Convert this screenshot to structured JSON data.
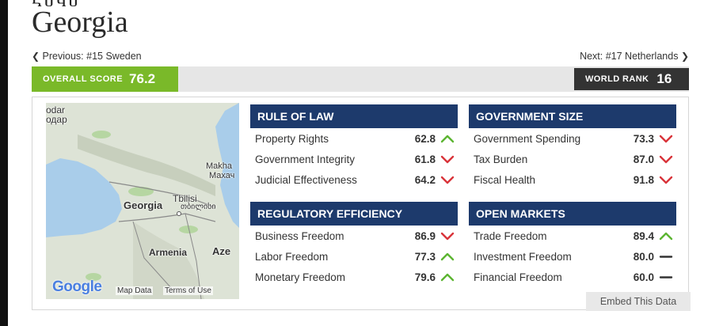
{
  "title_glyphs": "ႾႱႩႱ",
  "title": "Georgia",
  "navigation": {
    "previous_label": "Previous: #15 Sweden",
    "next_label": "Next: #17 Netherlands"
  },
  "overall_score": {
    "label": "OVERALL SCORE",
    "value": "76.2",
    "color": "#7ab929"
  },
  "world_rank": {
    "label": "WORLD RANK",
    "value": "16"
  },
  "map": {
    "labels": {
      "top_left_1": "odar",
      "top_left_2": "одар",
      "makha_1": "Makha",
      "makha_2": "Махач",
      "tbilisi_1": "Tbilisi",
      "tbilisi_2": "თბილისი",
      "georgia": "Georgia",
      "armenia": "Armenia",
      "aze": "Aze"
    },
    "google_logo": "Google",
    "map_data": "Map Data",
    "terms": "Terms of Use"
  },
  "categories": [
    {
      "title": "RULE OF LAW",
      "rows": [
        {
          "name": "Property Rights",
          "score": "62.8",
          "trend": "up"
        },
        {
          "name": "Government Integrity",
          "score": "61.8",
          "trend": "down"
        },
        {
          "name": "Judicial Effectiveness",
          "score": "64.2",
          "trend": "down"
        }
      ]
    },
    {
      "title": "GOVERNMENT SIZE",
      "rows": [
        {
          "name": "Government Spending",
          "score": "73.3",
          "trend": "down"
        },
        {
          "name": "Tax Burden",
          "score": "87.0",
          "trend": "down"
        },
        {
          "name": "Fiscal Health",
          "score": "91.8",
          "trend": "down"
        }
      ]
    },
    {
      "title": "REGULATORY EFFICIENCY",
      "rows": [
        {
          "name": "Business Freedom",
          "score": "86.9",
          "trend": "down"
        },
        {
          "name": "Labor Freedom",
          "score": "77.3",
          "trend": "up"
        },
        {
          "name": "Monetary Freedom",
          "score": "79.6",
          "trend": "up"
        }
      ]
    },
    {
      "title": "OPEN MARKETS",
      "rows": [
        {
          "name": "Trade Freedom",
          "score": "89.4",
          "trend": "up"
        },
        {
          "name": "Investment Freedom",
          "score": "80.0",
          "trend": "flat"
        },
        {
          "name": "Financial Freedom",
          "score": "60.0",
          "trend": "flat"
        }
      ]
    }
  ],
  "embed_label": "Embed This Data",
  "colors": {
    "header_navy": "#1d3a6c",
    "trend_up": "#5cb531",
    "trend_down": "#d9343a",
    "trend_flat": "#333333"
  }
}
